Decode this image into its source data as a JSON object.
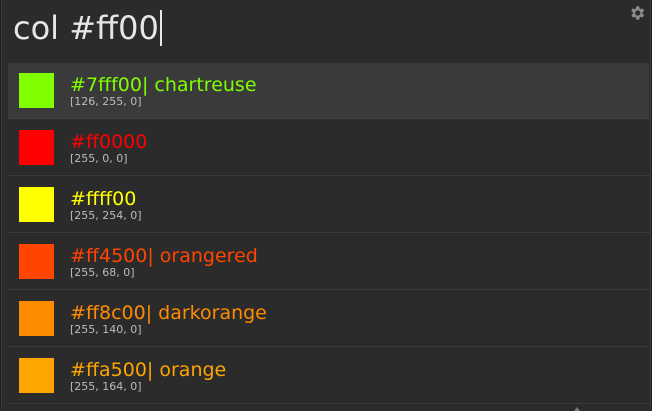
{
  "search": {
    "query": "col #ff00"
  },
  "settings": {
    "icon": "gear-icon"
  },
  "results": [
    {
      "title": "#7fff00| chartreuse",
      "subtitle": "[126, 255, 0]",
      "color": "#7fff00",
      "selected": true
    },
    {
      "title": "#ff0000",
      "subtitle": "[255, 0, 0]",
      "color": "#ff0000",
      "selected": false
    },
    {
      "title": "#ffff00",
      "subtitle": "[255, 254, 0]",
      "color": "#ffff00",
      "selected": false
    },
    {
      "title": "#ff4500| orangered",
      "subtitle": "[255, 68, 0]",
      "color": "#ff4500",
      "selected": false
    },
    {
      "title": "#ff8c00| darkorange",
      "subtitle": "[255, 140, 0]",
      "color": "#ff8c00",
      "selected": false
    },
    {
      "title": "#ffa500| orange",
      "subtitle": "[255, 164, 0]",
      "color": "#ffa500",
      "selected": false
    }
  ]
}
